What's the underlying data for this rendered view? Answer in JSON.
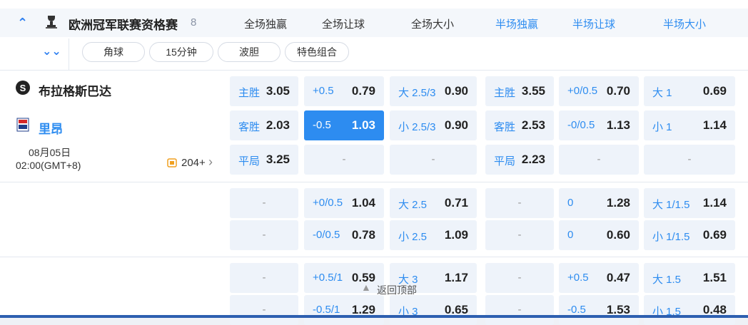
{
  "league": {
    "name": "欧洲冠军联赛资格赛",
    "count": "8"
  },
  "columns": [
    {
      "label": "全场独赢",
      "color": "#333333"
    },
    {
      "label": "全场让球",
      "color": "#333333"
    },
    {
      "label": "全场大小",
      "color": "#333333"
    },
    {
      "label": "半场独赢",
      "color": "#2d8cf0"
    },
    {
      "label": "半场让球",
      "color": "#2d8cf0"
    },
    {
      "label": "半场大小",
      "color": "#2d8cf0"
    }
  ],
  "filters": [
    "角球",
    "15分钟",
    "波胆",
    "特色组合"
  ],
  "match": {
    "home": "布拉格斯巴达",
    "away": "里昂",
    "date": "08月05日",
    "time": "02:00(GMT+8)",
    "more": "204+"
  },
  "rows": [
    [
      {
        "l": "主胜",
        "v": "3.05"
      },
      {
        "l": "+0.5",
        "v": "0.79"
      },
      {
        "l": "大 2.5/3",
        "v": "0.90"
      },
      {
        "l": "主胜",
        "v": "3.55"
      },
      {
        "l": "+0/0.5",
        "v": "0.70"
      },
      {
        "l": "大 1",
        "v": "0.69"
      }
    ],
    [
      {
        "l": "客胜",
        "v": "2.03"
      },
      {
        "l": "-0.5",
        "v": "1.03",
        "hl": true
      },
      {
        "l": "小 2.5/3",
        "v": "0.90"
      },
      {
        "l": "客胜",
        "v": "2.53"
      },
      {
        "l": "-0/0.5",
        "v": "1.13"
      },
      {
        "l": "小 1",
        "v": "1.14"
      }
    ],
    [
      {
        "l": "平局",
        "v": "3.25"
      },
      {
        "dash": "-"
      },
      {
        "dash": "-"
      },
      {
        "l": "平局",
        "v": "2.23"
      },
      {
        "dash": "-"
      },
      {
        "dash": "-"
      }
    ],
    [
      {
        "dash": "-"
      },
      {
        "l": "+0/0.5",
        "v": "1.04"
      },
      {
        "l": "大 2.5",
        "v": "0.71"
      },
      {
        "dash": "-"
      },
      {
        "l": "0",
        "v": "1.28"
      },
      {
        "l": "大 1/1.5",
        "v": "1.14"
      }
    ],
    [
      {
        "dash": "-"
      },
      {
        "l": "-0/0.5",
        "v": "0.78"
      },
      {
        "l": "小 2.5",
        "v": "1.09"
      },
      {
        "dash": "-"
      },
      {
        "l": "0",
        "v": "0.60"
      },
      {
        "l": "小 1/1.5",
        "v": "0.69"
      }
    ],
    [
      {
        "dash": "-"
      },
      {
        "l": "+0.5/1",
        "v": "0.59"
      },
      {
        "l": "大 3",
        "v": "1.17"
      },
      {
        "dash": "-"
      },
      {
        "l": "+0.5",
        "v": "0.47"
      },
      {
        "l": "大 1.5",
        "v": "1.51"
      }
    ],
    [
      {
        "dash": "-"
      },
      {
        "l": "-0.5/1",
        "v": "1.29"
      },
      {
        "l": "小 3",
        "v": "0.65"
      },
      {
        "dash": "-"
      },
      {
        "l": "-0.5",
        "v": "1.53"
      },
      {
        "l": "小 1.5",
        "v": "0.48"
      }
    ]
  ],
  "back_to_top": "返回顶部"
}
